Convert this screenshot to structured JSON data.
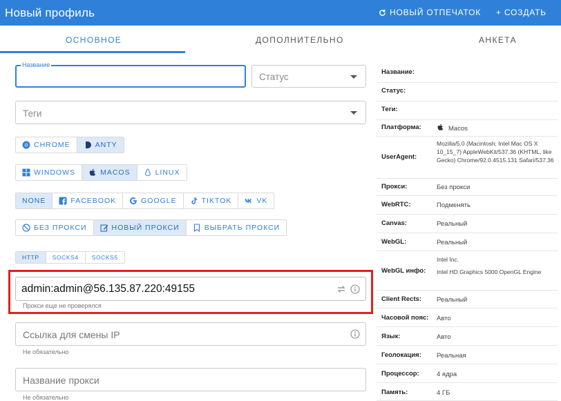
{
  "header": {
    "title": "Новый профиль",
    "fingerprint_label": "НОВЫЙ ОТПЕЧАТОК",
    "create_label": "+ СОЗДАТЬ",
    "bg_color": "#2f80d8"
  },
  "tabs": [
    {
      "label": "ОСНОВНОЕ",
      "active": true
    },
    {
      "label": "ДОПОЛНИТЕЛЬНО",
      "active": false
    },
    {
      "label": "АНКЕТА",
      "active": false
    }
  ],
  "form": {
    "name_label": "Название",
    "name_value": "",
    "status_placeholder": "Статус",
    "tags_placeholder": "Теги",
    "browser": [
      {
        "label": "CHROME",
        "icon": "chrome-icon",
        "active": false
      },
      {
        "label": "ANTY",
        "icon": "anty-icon",
        "active": true
      }
    ],
    "os": [
      {
        "label": "WINDOWS",
        "icon": "windows-icon",
        "active": false
      },
      {
        "label": "MACOS",
        "icon": "apple-icon",
        "active": true
      },
      {
        "label": "LINUX",
        "icon": "linux-icon",
        "active": false
      }
    ],
    "social": [
      {
        "label": "NONE",
        "icon": "",
        "active": true
      },
      {
        "label": "FACEBOOK",
        "icon": "facebook-icon",
        "active": false
      },
      {
        "label": "GOOGLE",
        "icon": "google-icon",
        "active": false
      },
      {
        "label": "TIKTOK",
        "icon": "tiktok-icon",
        "active": false
      },
      {
        "label": "VK",
        "icon": "vk-icon",
        "active": false
      }
    ],
    "proxy_modes": [
      {
        "label": "БЕЗ ПРОКСИ",
        "icon": "no-proxy-icon",
        "active": false
      },
      {
        "label": "НОВЫЙ ПРОКСИ",
        "icon": "edit-icon",
        "active": true
      },
      {
        "label": "ВЫБРАТЬ ПРОКСИ",
        "icon": "bookmark-icon",
        "active": false
      }
    ],
    "protocols": [
      {
        "label": "HTTP",
        "active": true
      },
      {
        "label": "SOCKS4",
        "active": false
      },
      {
        "label": "SOCKS5",
        "active": false
      }
    ],
    "proxy_value": "admin:admin@56.135.87.220:49155",
    "proxy_hint": "Прокси еще не проверялся",
    "ip_change_placeholder": "Ссылка для смены IP",
    "ip_change_hint": "Не обязательно",
    "proxy_name_placeholder": "Название прокси",
    "proxy_name_hint": "Не обязательно"
  },
  "summary": [
    {
      "key": "Название:",
      "value": ""
    },
    {
      "key": "Статус:",
      "value": ""
    },
    {
      "key": "Теги:",
      "value": ""
    },
    {
      "key": "Платформа:",
      "value": "Macos",
      "icon": "apple-icon"
    },
    {
      "key": "UserAgent:",
      "value": "Mozilla/5.0 (Macintosh; Intel Mac OS X 10_15_7) AppleWebKit/537.36 (KHTML, like Gecko) Chrome/92.0.4515.131 Safari/537.36"
    },
    {
      "key": "Прокси:",
      "value": "Без прокси"
    },
    {
      "key": "WebRTC:",
      "value": "Подменять"
    },
    {
      "key": "Canvas:",
      "value": "Реальный"
    },
    {
      "key": "WebGL:",
      "value": "Реальный"
    },
    {
      "key": "WebGL инфо:",
      "value": "Intel Inc.",
      "value2": "Intel HD Graphics 5000 OpenGL Engine"
    },
    {
      "key": "Client Rects:",
      "value": "Реальный"
    },
    {
      "key": "Часовой пояс:",
      "value": "Авто"
    },
    {
      "key": "Язык:",
      "value": "Авто"
    },
    {
      "key": "Геолокация:",
      "value": "Реальная"
    },
    {
      "key": "Процессор:",
      "value": "4 ядра"
    },
    {
      "key": "Память:",
      "value": "4 ГБ"
    }
  ]
}
